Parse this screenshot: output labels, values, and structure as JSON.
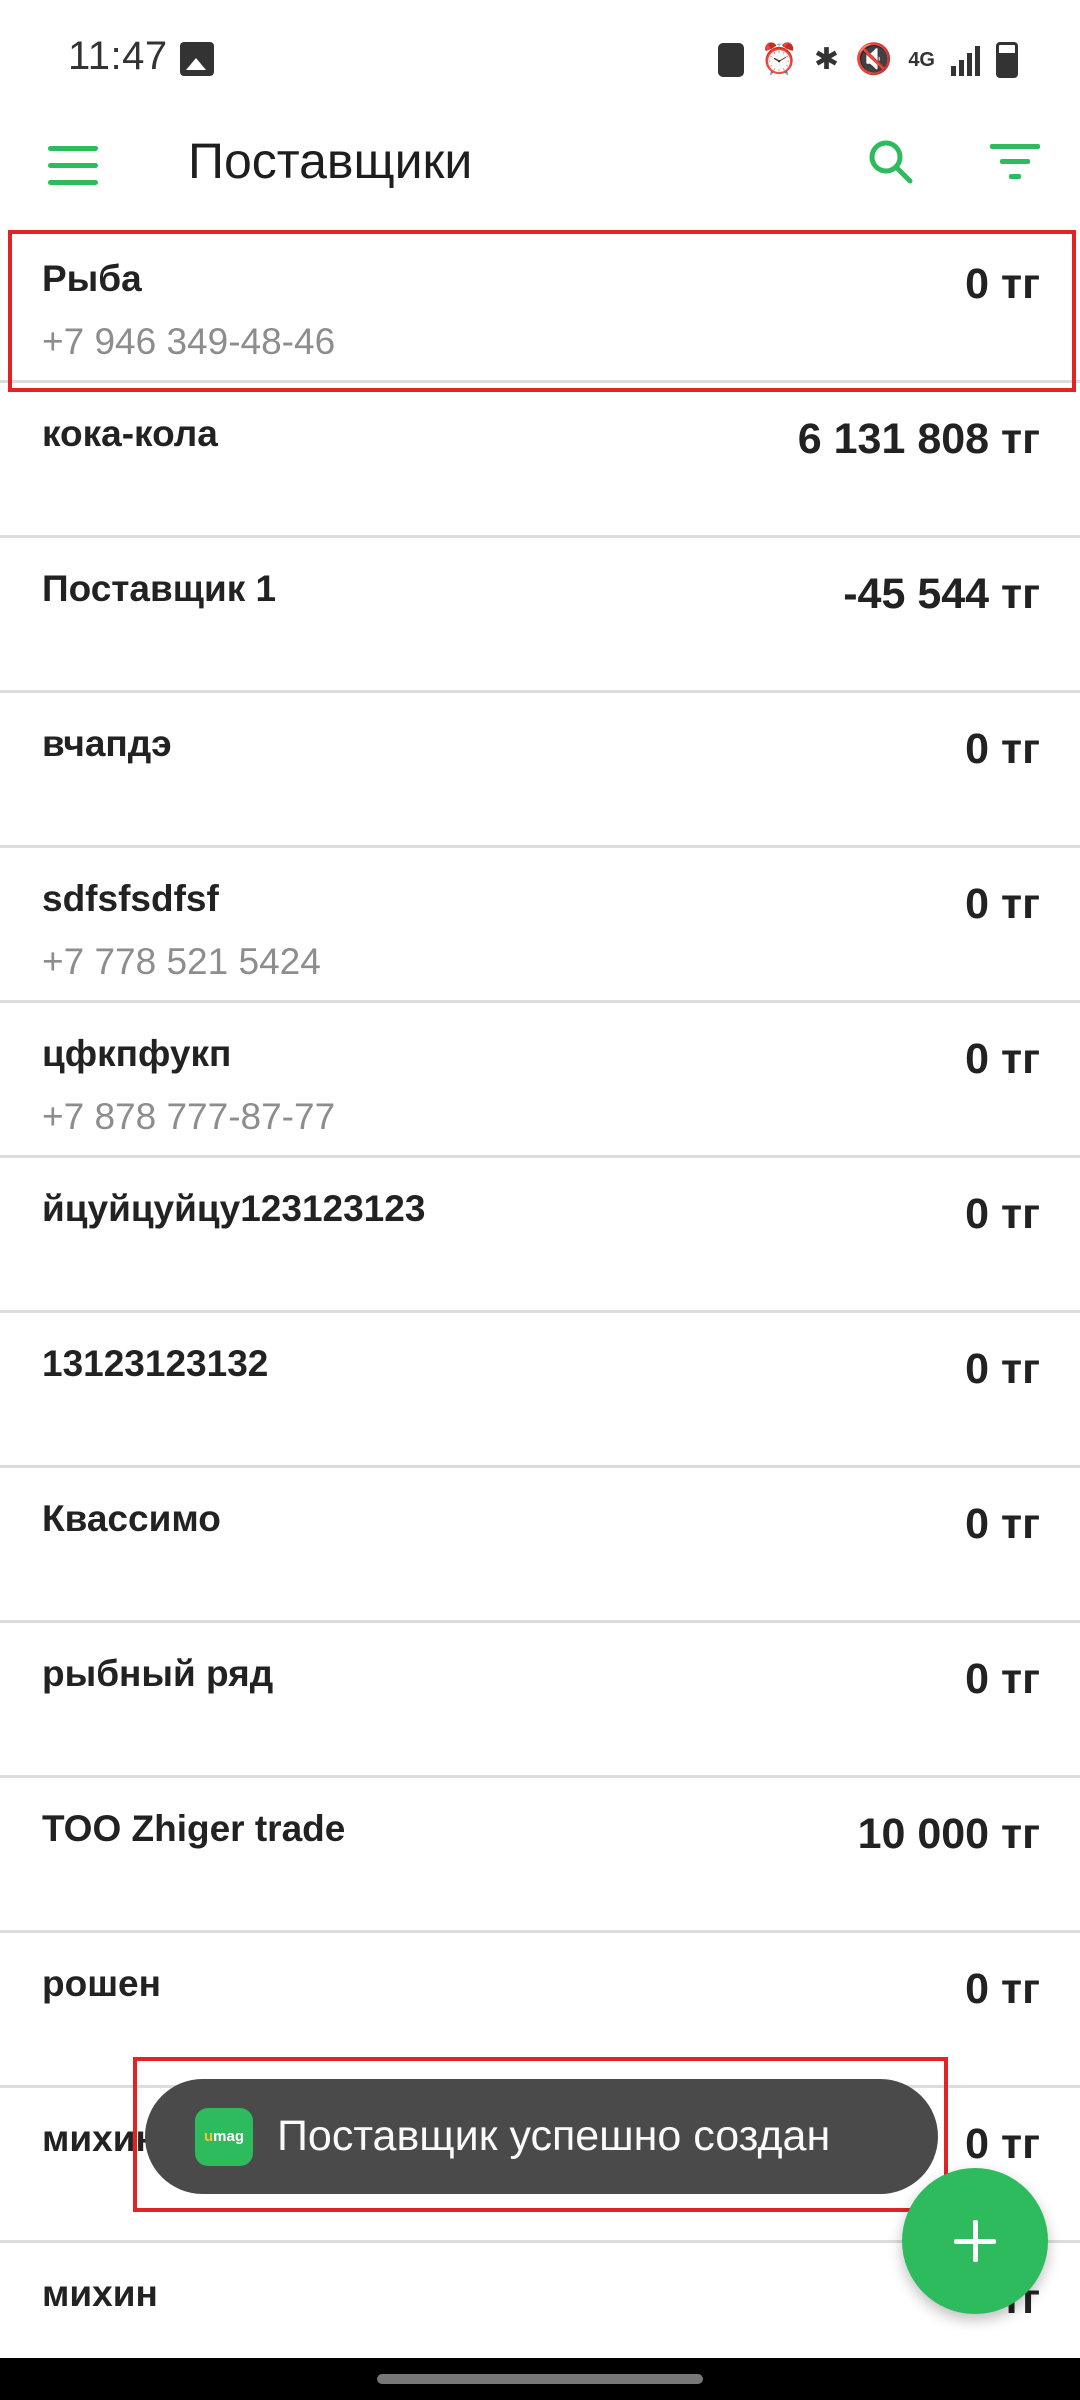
{
  "status_bar": {
    "time": "11:47",
    "icons": [
      "gallery-icon",
      "battery-saver-icon",
      "alarm-icon",
      "bluetooth-icon",
      "mute-icon",
      "4g-icon",
      "signal-icon",
      "battery-icon"
    ],
    "network_label": "4G"
  },
  "toolbar": {
    "title": "Поставщики",
    "menu_icon": "hamburger-menu-icon",
    "search_icon": "search-icon",
    "filter_icon": "filter-icon"
  },
  "suppliers": [
    {
      "name": "Рыба",
      "phone": "+7 946 349-48-46",
      "amount": "0 тг"
    },
    {
      "name": "кока-кола",
      "phone": "",
      "amount": "6 131 808 тг"
    },
    {
      "name": "Поставщик 1",
      "phone": "",
      "amount": "-45 544 тг"
    },
    {
      "name": "вчапдэ",
      "phone": "",
      "amount": "0 тг"
    },
    {
      "name": "sdfsfsdfsf",
      "phone": "+7 778 521 5424",
      "amount": "0 тг"
    },
    {
      "name": "цфкпфукп",
      "phone": "+7 878 777-87-77",
      "amount": "0 тг"
    },
    {
      "name": "йцуйцуйцу123123123",
      "phone": "",
      "amount": "0 тг"
    },
    {
      "name": "13123123132",
      "phone": "",
      "amount": "0 тг"
    },
    {
      "name": "Квассимо",
      "phone": "",
      "amount": "0 тг"
    },
    {
      "name": "рыбный ряд",
      "phone": "",
      "amount": "0 тг"
    },
    {
      "name": "ТОО Zhiger trade",
      "phone": "",
      "amount": "10 000 тг"
    },
    {
      "name": "рошен",
      "phone": "",
      "amount": "0 тг"
    },
    {
      "name": "михин",
      "phone": "",
      "amount": "0 тг"
    },
    {
      "name": "михин",
      "phone": "",
      "amount": "тг"
    }
  ],
  "toast": {
    "logo_text_u": "u",
    "logo_text_rest": "mag",
    "message": "Поставщик успешно создан"
  },
  "fab": {
    "icon": "plus-icon"
  },
  "colors": {
    "accent": "#2dbb5d",
    "highlight": "#e02424",
    "toast_bg": "#4a4a4a"
  }
}
